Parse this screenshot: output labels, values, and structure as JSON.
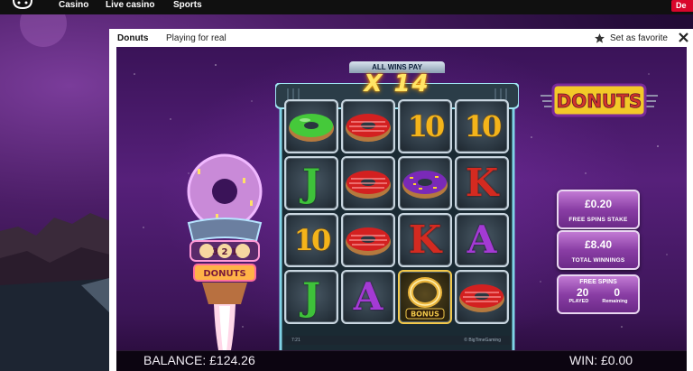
{
  "nav": {
    "items": [
      "Casino",
      "Live casino",
      "Sports"
    ],
    "cta": "De"
  },
  "game_window": {
    "title": "Donuts",
    "mode": "Playing for real",
    "favorite_label": "Set as favorite"
  },
  "game": {
    "all_wins_pay": "ALL WINS PAY",
    "multiplier": "X 14",
    "logo_text": "DONUTS",
    "rocket_countdown": "3 2 1",
    "rocket_label": "DONUTS",
    "reels": [
      [
        "green-donut",
        "10",
        "10"
      ],
      [
        "J",
        "red-donut",
        "purple-donut",
        "K"
      ],
      [
        "10",
        "red-donut",
        "K",
        "A"
      ],
      [
        "J",
        "A",
        "bonus",
        "red-donut"
      ]
    ],
    "reel_grid": [
      [
        "green-donut",
        "red-donut",
        "10",
        "10"
      ],
      [
        "J",
        "red-donut",
        "purple-donut",
        "K"
      ],
      [
        "10",
        "red-donut",
        "K",
        "A"
      ],
      [
        "J",
        "A",
        "bonus",
        "red-donut"
      ]
    ],
    "bonus_label": "BONUS",
    "footer_time": "7:21",
    "footer_brand": "© BigTimeGaming",
    "free_spins_stake": {
      "value": "£0.20",
      "label": "FREE SPINS STAKE"
    },
    "total_winnings": {
      "value": "£8.40",
      "label": "TOTAL WINNINGS"
    },
    "free_spins": {
      "header": "FREE SPINS",
      "played": "20",
      "remaining": "0",
      "played_label": "PLAYED",
      "remaining_label": "Remaining"
    }
  },
  "footer": {
    "balance": "BALANCE: £124.26",
    "win": "WIN: £0.00"
  },
  "colors": {
    "nav_bg": "#101010",
    "cta": "#d9062b",
    "panel_purple": "#8a3ea5",
    "multiplier_gold": "#ffe566"
  }
}
